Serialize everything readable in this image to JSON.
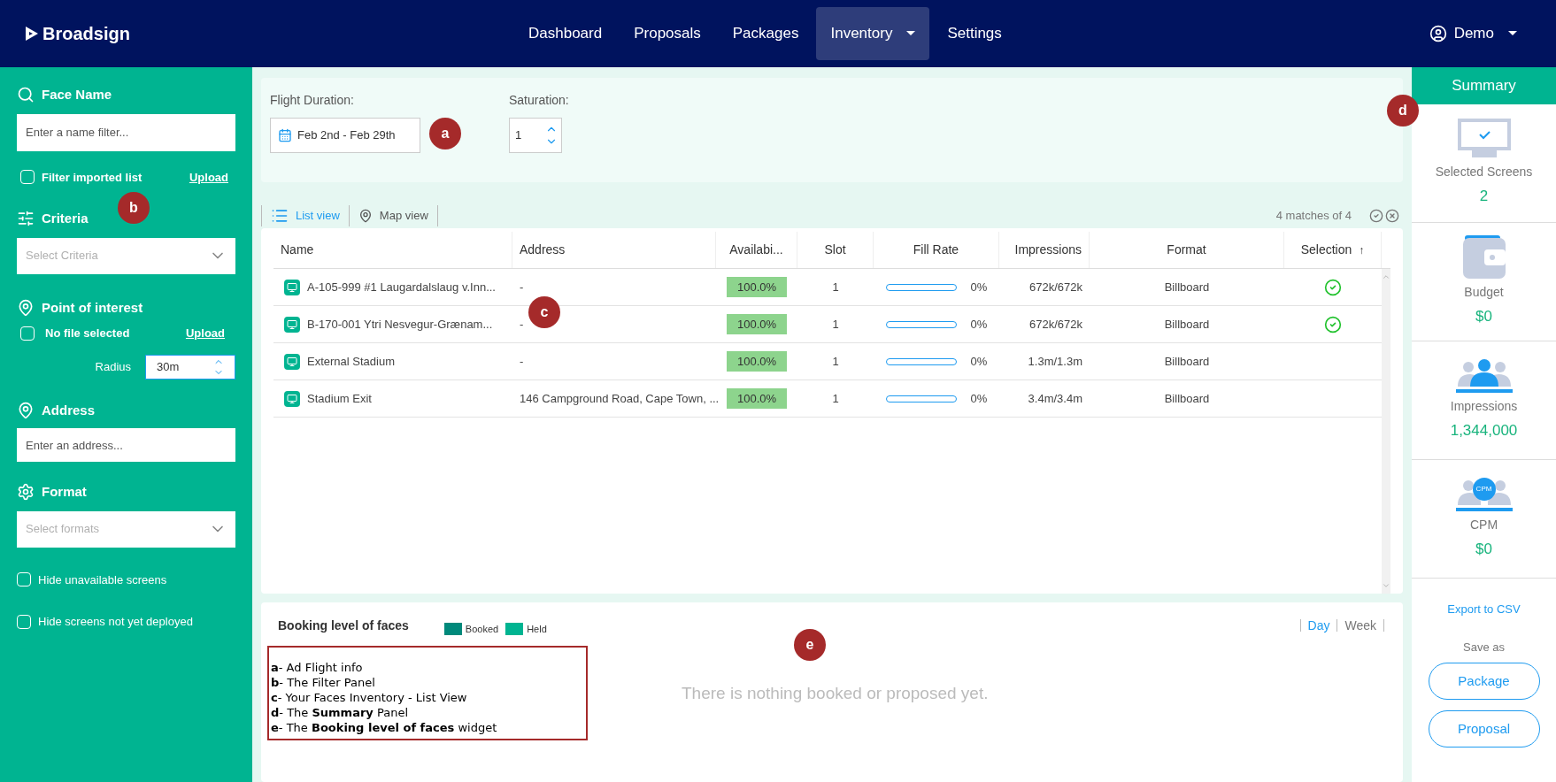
{
  "nav": {
    "brand": "Broadsign",
    "items": [
      {
        "label": "Dashboard",
        "selected": false,
        "dropdown": false
      },
      {
        "label": "Proposals",
        "selected": false,
        "dropdown": false
      },
      {
        "label": "Packages",
        "selected": false,
        "dropdown": false
      },
      {
        "label": "Inventory",
        "selected": true,
        "dropdown": true
      },
      {
        "label": "Settings",
        "selected": false,
        "dropdown": false
      }
    ],
    "user": "Demo"
  },
  "filters": {
    "face_name": {
      "title": "Face Name",
      "placeholder": "Enter a name filter..."
    },
    "filter_imported": {
      "label": "Filter imported list",
      "checked": false,
      "link": "Upload"
    },
    "criteria": {
      "title": "Criteria",
      "placeholder": "Select Criteria"
    },
    "poi": {
      "title": "Point of interest",
      "file": {
        "label": "No file selected",
        "checked": false,
        "link": "Upload"
      },
      "radius_label": "Radius",
      "radius": "30m"
    },
    "address": {
      "title": "Address",
      "placeholder": "Enter an address..."
    },
    "format": {
      "title": "Format",
      "placeholder": "Select formats"
    },
    "options": [
      {
        "label": "Hide unavailable screens",
        "checked": false
      },
      {
        "label": "Hide screens not yet deployed",
        "checked": false
      }
    ]
  },
  "flight": {
    "duration_label": "Flight Duration:",
    "duration": "Feb 2nd - Feb 29th",
    "saturation_label": "Saturation:",
    "saturation": "1"
  },
  "views": [
    {
      "label": "List view",
      "selected": true,
      "kind": "list"
    },
    {
      "label": "Map view",
      "selected": false,
      "kind": "map"
    }
  ],
  "matches": "4 matches of 4",
  "table": {
    "columns": [
      "Name",
      "Address",
      "Availabi...",
      "Slot",
      "Fill Rate",
      "Impressions",
      "Format",
      "Selection"
    ],
    "sort_icon": "↑",
    "rows": [
      {
        "name": "A-105-999 #1 Laugardalslaug v.Inn...",
        "address": "-",
        "availability": "100.0%",
        "slot": "1",
        "level": 0,
        "fill": "0%",
        "impressions": "672k/672k",
        "format": "Billboard",
        "selected": true
      },
      {
        "name": "B-170-001 Ytri Nesvegur-Grænam...",
        "address": "-",
        "availability": "100.0%",
        "slot": "1",
        "level": 0,
        "fill": "0%",
        "impressions": "672k/672k",
        "format": "Billboard",
        "selected": true
      },
      {
        "name": "External Stadium",
        "address": "-",
        "availability": "100.0%",
        "slot": "1",
        "level": 0,
        "fill": "0%",
        "impressions": "1.3m/1.3m",
        "format": "Billboard",
        "selected": false
      },
      {
        "name": "Stadium Exit",
        "address": "146 Campground Road, Cape Town, ...",
        "availability": "100.0%",
        "slot": "1",
        "level": 0,
        "fill": "0%",
        "impressions": "3.4m/3.4m",
        "format": "Billboard",
        "selected": false
      }
    ]
  },
  "booking": {
    "title": "Booking level of faces",
    "legend": [
      {
        "label": "Booked",
        "color": "#00897b"
      },
      {
        "label": "Held",
        "color": "#00b491"
      }
    ],
    "periods": [
      {
        "label": "Day",
        "selected": true
      },
      {
        "label": "Week",
        "selected": false
      }
    ],
    "empty": "There is nothing booked or proposed yet."
  },
  "legend_box": [
    "**a**- Ad Flight info",
    "**b**- The Filter Panel",
    "**c**- Your Faces Inventory - List View",
    "**d**- The **Summary** Panel",
    "**e**- The **Booking level of faces** widget"
  ],
  "markers": [
    "a",
    "b",
    "c",
    "d",
    "e"
  ],
  "summary": {
    "title": "Summary",
    "cards": [
      {
        "kind": "screens",
        "label": "Selected Screens",
        "value": "2"
      },
      {
        "kind": "budget",
        "label": "Budget",
        "value": "$0"
      },
      {
        "kind": "impressions",
        "label": "Impressions",
        "value": "1,344,000"
      },
      {
        "kind": "cpm",
        "label": "CPM",
        "value": "$0",
        "badge": "CPM"
      }
    ],
    "export": "Export to CSV",
    "save_as": "Save as",
    "buttons": [
      "Package",
      "Proposal"
    ]
  }
}
